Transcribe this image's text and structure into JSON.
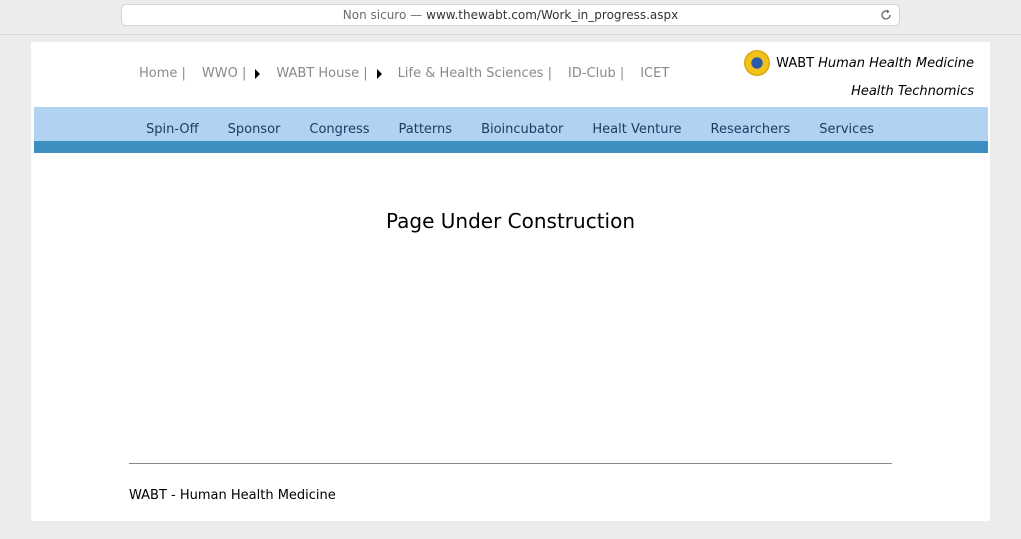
{
  "browser": {
    "security_label": "Non sicuro —",
    "url": "www.thewabt.com/Work_in_progress.aspx"
  },
  "topnav": {
    "home": "Home |",
    "wwo": "WWO |",
    "wabt_house": "WABT House |",
    "life_health": "Life & Health Sciences |",
    "id_club": "ID-Club |",
    "icet": "ICET"
  },
  "brand": {
    "name": "WABT",
    "tagline": "Human Health Medicine",
    "subtitle": "Health Technomics"
  },
  "mainnav": {
    "items": [
      "Spin-Off",
      "Sponsor",
      "Congress",
      "Patterns",
      "Bioincubator",
      "Healt Venture",
      "Researchers",
      "Services"
    ]
  },
  "content": {
    "title": "Page Under Construction"
  },
  "footer": {
    "text": "WABT - Human Health Medicine"
  },
  "colors": {
    "nav_bg": "#b1d2f1",
    "nav_bar": "#3d8fc2"
  }
}
